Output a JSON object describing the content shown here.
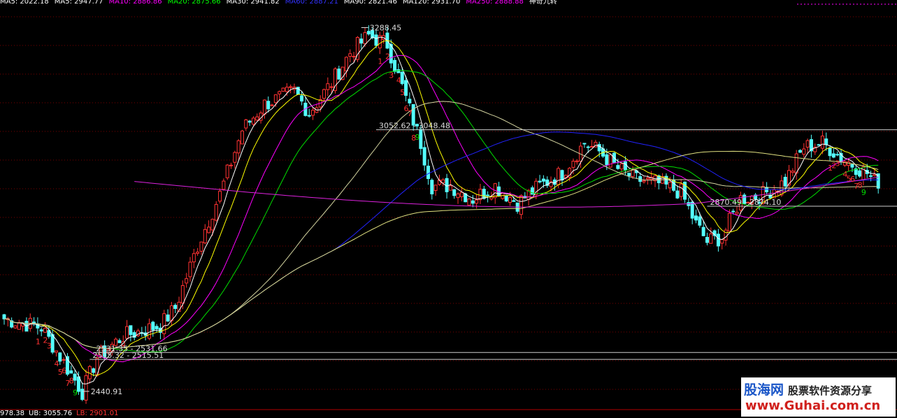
{
  "top_legend": [
    {
      "text": "MA5: 2022.18",
      "color": "#ffffff"
    },
    {
      "text": "MA5: 2947.77",
      "color": "#ffffff"
    },
    {
      "text": "MA10: 2886.86",
      "color": "#ff00ff"
    },
    {
      "text": "MA20: 2875.66",
      "color": "#00ff00"
    },
    {
      "text": "MA30: 2941.82",
      "color": "#ffffff"
    },
    {
      "text": "MA60: 2887.21",
      "color": "#3333ff"
    },
    {
      "text": "MA90: 2821.46",
      "color": "#ffffff"
    },
    {
      "text": "MA120: 2931.70",
      "color": "#ffffff"
    },
    {
      "text": "MA250: 2888.88",
      "color": "#ff00ff"
    },
    {
      "text": "神奇九转",
      "color": "#ffffff"
    }
  ],
  "bottom_legend": [
    {
      "text": "978.38",
      "color": "#ffffff"
    },
    {
      "text": "UB: 3055.76",
      "color": "#ffffff"
    },
    {
      "text": "LB: 2901.01",
      "color": "#ff3333"
    }
  ],
  "watermark": {
    "logo": "股海网",
    "subtitle": "股票软件资源分享",
    "url": "www.Guhai.com.cn"
  },
  "colors": {
    "up": "#ff3232",
    "down": "#54fcfc",
    "ma5": "#ffffff",
    "ma10": "#ffff00",
    "ma20": "#ff00ff",
    "ma30": "#00dd00",
    "ma60": "#d4d4a0",
    "ma120": "#2222ff",
    "ma250": "#e0e080",
    "ma_long": "#dd22dd"
  },
  "chart_data": {
    "type": "candlestick",
    "y_range": [
      2400,
      3330
    ],
    "price_annotations": [
      {
        "text": "3288.45",
        "value": 3288.45,
        "index": 96
      },
      {
        "text": "2440.91",
        "value": 2440.91,
        "index": 21
      }
    ],
    "support_resistance": [
      {
        "text": "3052.62 - 3048.48",
        "value": 3050.5,
        "from_index": 100
      },
      {
        "text": "2870.49 - 2874.10",
        "value": 2872.3,
        "from_index": 189
      },
      {
        "text": "2531.35 - 2531.66",
        "value": 2531.5,
        "from_index": 24
      },
      {
        "text": "2515.32 - 2515.51",
        "value": 2515.4,
        "from_index": 23
      }
    ],
    "nine_turn_labels": [
      {
        "text": "1",
        "index": 9,
        "color": "#ff3232"
      },
      {
        "text": "2",
        "index": 11,
        "color": "#ff3232"
      },
      {
        "text": "3",
        "index": 12,
        "color": "#ff3232"
      },
      {
        "text": "4",
        "index": 14,
        "color": "#ff3232"
      },
      {
        "text": "5",
        "index": 15,
        "color": "#ff3232"
      },
      {
        "text": "6",
        "index": 16,
        "color": "#ff3232"
      },
      {
        "text": "7",
        "index": 17,
        "color": "#ff3232"
      },
      {
        "text": "8",
        "index": 18,
        "color": "#ff3232"
      },
      {
        "text": "9",
        "index": 19,
        "color": "#00dd00"
      },
      {
        "text": "1",
        "index": 101,
        "color": "#ff3232"
      },
      {
        "text": "2",
        "index": 103,
        "color": "#ff3232"
      },
      {
        "text": "3",
        "index": 104,
        "color": "#ff3232"
      },
      {
        "text": "4",
        "index": 106,
        "color": "#ff3232"
      },
      {
        "text": "5",
        "index": 107,
        "color": "#ff3232"
      },
      {
        "text": "6",
        "index": 108,
        "color": "#ff3232"
      },
      {
        "text": "7",
        "index": 109,
        "color": "#ff3232"
      },
      {
        "text": "8",
        "index": 110,
        "color": "#ff3232"
      },
      {
        "text": "9",
        "index": 111,
        "color": "#00dd00"
      },
      {
        "text": "1",
        "index": 222,
        "color": "#ff3232"
      },
      {
        "text": "2",
        "index": 223,
        "color": "#ff3232"
      },
      {
        "text": "3",
        "index": 224,
        "color": "#ff3232"
      },
      {
        "text": "4",
        "index": 226,
        "color": "#ff3232"
      },
      {
        "text": "5",
        "index": 227,
        "color": "#ff3232"
      },
      {
        "text": "6",
        "index": 228,
        "color": "#ff3232"
      },
      {
        "text": "7",
        "index": 229,
        "color": "#ff3232"
      },
      {
        "text": "8",
        "index": 230,
        "color": "#ff3232"
      },
      {
        "text": "9",
        "index": 231,
        "color": "#00dd00"
      }
    ],
    "close_anchors": [
      [
        0,
        2610
      ],
      [
        10,
        2590
      ],
      [
        21,
        2440
      ],
      [
        25,
        2520
      ],
      [
        32,
        2570
      ],
      [
        42,
        2595
      ],
      [
        46,
        2635
      ],
      [
        52,
        2780
      ],
      [
        58,
        2900
      ],
      [
        64,
        3050
      ],
      [
        70,
        3110
      ],
      [
        78,
        3140
      ],
      [
        82,
        3090
      ],
      [
        88,
        3160
      ],
      [
        93,
        3230
      ],
      [
        98,
        3270
      ],
      [
        103,
        3250
      ],
      [
        107,
        3150
      ],
      [
        112,
        3020
      ],
      [
        115,
        2920
      ],
      [
        120,
        2920
      ],
      [
        126,
        2890
      ],
      [
        132,
        2920
      ],
      [
        138,
        2880
      ],
      [
        144,
        2920
      ],
      [
        150,
        2950
      ],
      [
        156,
        3020
      ],
      [
        160,
        3000
      ],
      [
        165,
        2960
      ],
      [
        170,
        2935
      ],
      [
        176,
        2925
      ],
      [
        182,
        2905
      ],
      [
        186,
        2830
      ],
      [
        189,
        2790
      ],
      [
        193,
        2800
      ],
      [
        198,
        2890
      ],
      [
        204,
        2900
      ],
      [
        210,
        2930
      ],
      [
        215,
        3010
      ],
      [
        220,
        3020
      ],
      [
        226,
        2980
      ],
      [
        232,
        2950
      ],
      [
        234,
        2930
      ]
    ]
  }
}
